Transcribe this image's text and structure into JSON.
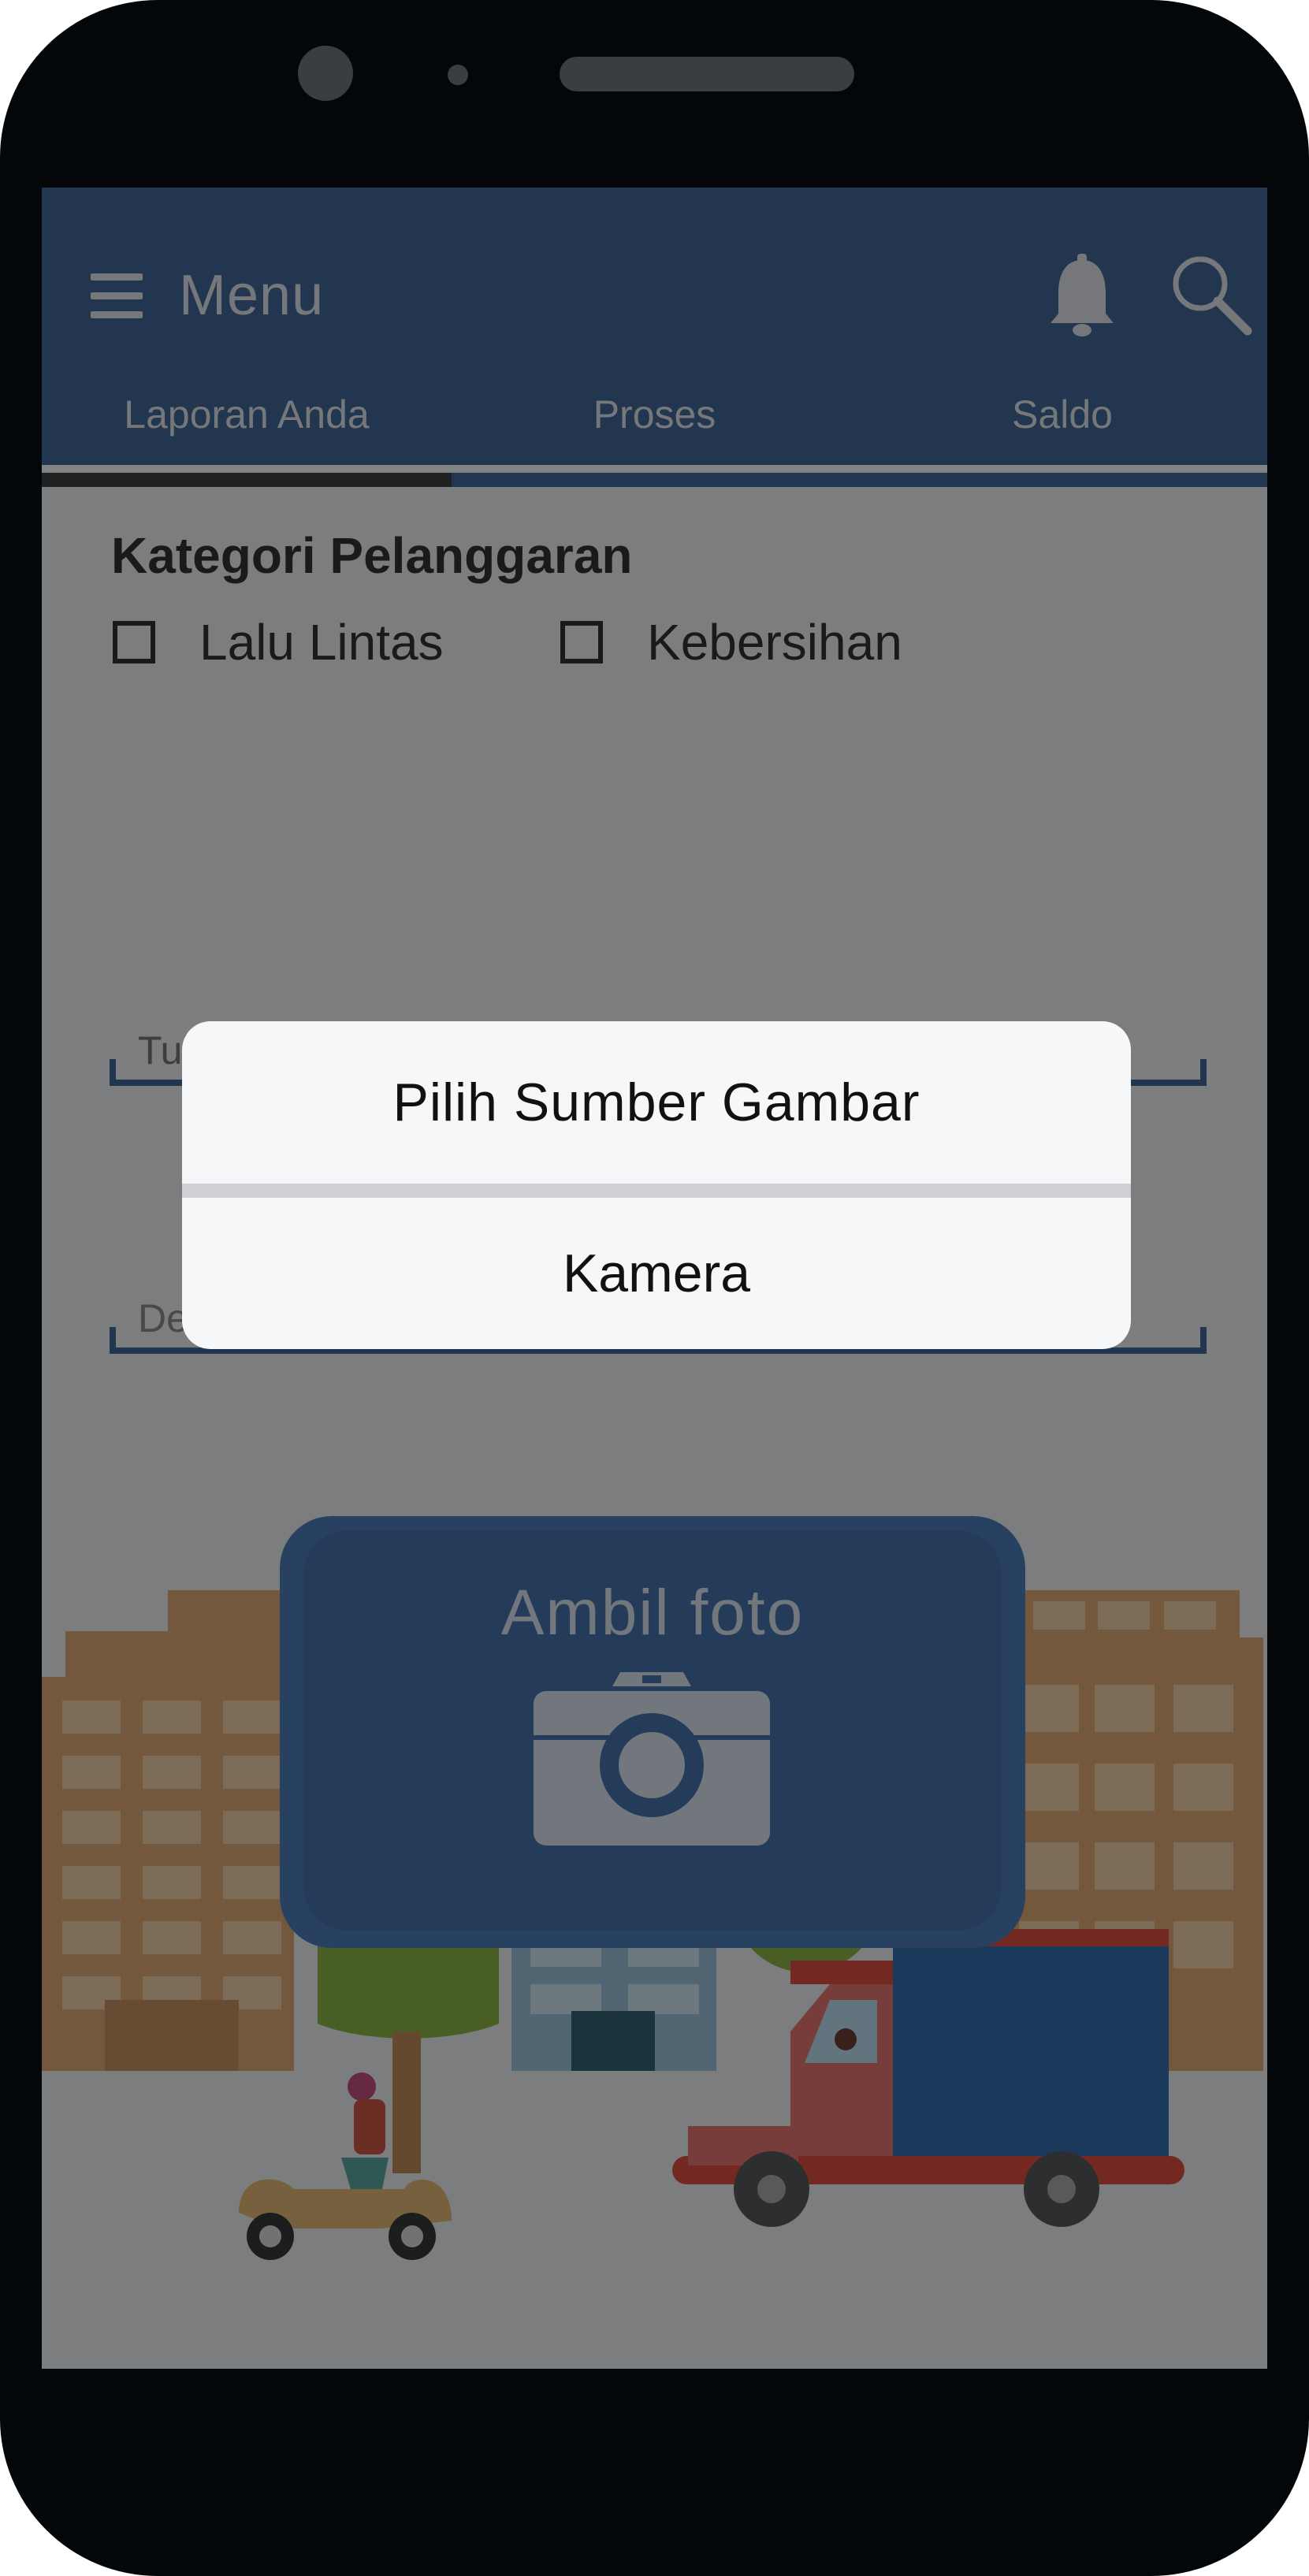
{
  "app_bar": {
    "menu_label": "Menu",
    "bell_icon": "bell-icon",
    "search_icon": "search-icon"
  },
  "tabs": [
    {
      "label": "Laporan Anda",
      "active": true
    },
    {
      "label": "Proses",
      "active": false
    },
    {
      "label": "Saldo",
      "active": false
    }
  ],
  "form": {
    "category_title": "Kategori Pelanggaran",
    "categories": [
      {
        "label": "Lalu Lintas",
        "checked": false
      },
      {
        "label": "Kebersihan",
        "checked": false
      }
    ],
    "report_placeholder": "Tuliskan Laporan Anda.....",
    "second_field_visible_text": "De"
  },
  "photo_button": {
    "label": "Ambil foto",
    "icon": "camera-icon"
  },
  "dialog": {
    "title": "Pilih Sumber Gambar",
    "options": [
      "Kamera"
    ]
  },
  "colors": {
    "primary": "#3f6592",
    "button": "#4a7bb4",
    "overlay": "rgba(5,8,12,0.50)",
    "dialog_bg": "#f6f7f9"
  }
}
